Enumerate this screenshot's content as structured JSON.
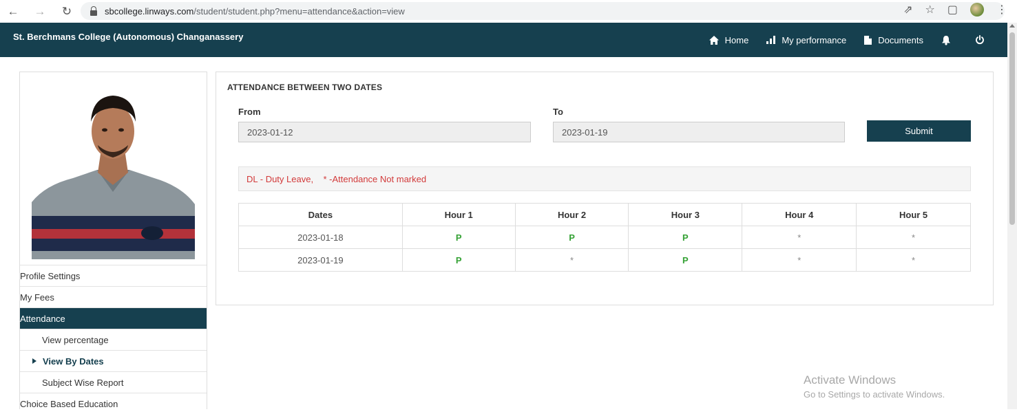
{
  "browser": {
    "url_host": "sbcollege.linways.com",
    "url_path": "/student/student.php?menu=attendance&action=view"
  },
  "header": {
    "brand": "St. Berchmans College (Autonomous) Changanassery",
    "nav": [
      {
        "label": "Home",
        "icon": "home-icon"
      },
      {
        "label": "My performance",
        "icon": "signal-bars-icon"
      },
      {
        "label": "Documents",
        "icon": "document-icon"
      }
    ]
  },
  "sidebar": {
    "menu": [
      {
        "label": "Profile Settings",
        "type": "item"
      },
      {
        "label": "My Fees",
        "type": "item"
      },
      {
        "label": "Attendance",
        "type": "active"
      },
      {
        "label": "View percentage",
        "type": "sub"
      },
      {
        "label": "View By Dates",
        "type": "sub-current"
      },
      {
        "label": "Subject Wise Report",
        "type": "sub"
      },
      {
        "label": "Choice Based Education",
        "type": "item"
      }
    ]
  },
  "main": {
    "title": "ATTENDANCE BETWEEN TWO DATES",
    "from_label": "From",
    "from_value": "2023-01-12",
    "to_label": "To",
    "to_value": "2023-01-19",
    "submit_label": "Submit",
    "legend": "DL - Duty Leave,    * -Attendance Not marked",
    "table": {
      "headers": [
        "Dates",
        "Hour 1",
        "Hour 2",
        "Hour 3",
        "Hour 4",
        "Hour 5"
      ],
      "rows": [
        [
          "2023-01-18",
          "P",
          "P",
          "P",
          "*",
          "*"
        ],
        [
          "2023-01-19",
          "P",
          "*",
          "P",
          "*",
          "*"
        ]
      ]
    }
  },
  "watermark": {
    "line1": "Activate Windows",
    "line2": "Go to Settings to activate Windows."
  },
  "colors": {
    "primary": "#16404f",
    "present": "#35a235",
    "legend_text": "#d23a3a"
  }
}
